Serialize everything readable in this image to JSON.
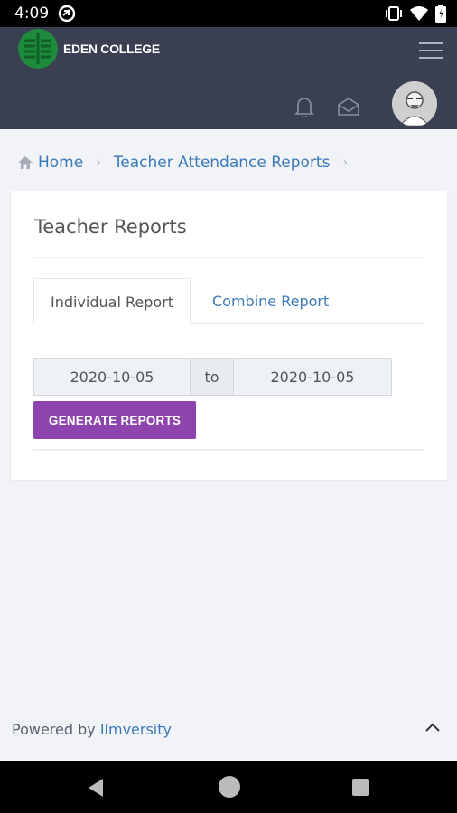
{
  "status_bar": {
    "time": "4:09"
  },
  "header": {
    "logo_text": "EDEN COLLEGE"
  },
  "breadcrumb": {
    "home": "Home",
    "current": "Teacher Attendance Reports"
  },
  "card": {
    "title": "Teacher Reports",
    "tabs": [
      {
        "label": "Individual Report"
      },
      {
        "label": "Combine Report"
      }
    ],
    "date_from": "2020-10-05",
    "date_separator": "to",
    "date_to": "2020-10-05",
    "generate_label": "GENERATE REPORTS"
  },
  "footer": {
    "prefix": "Powered by",
    "brand": "Ilmversity"
  },
  "colors": {
    "header_bg": "#3a3f51",
    "accent": "#8e44ad",
    "link": "#3b7ab8"
  }
}
